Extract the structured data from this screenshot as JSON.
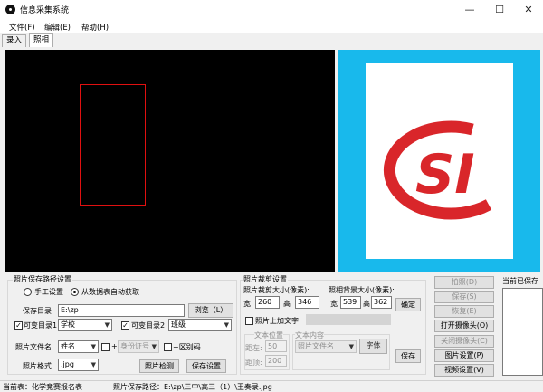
{
  "window": {
    "title": "信息采集系统",
    "buttons": {
      "minimize": "—",
      "maximize": "☐",
      "close": "✕"
    }
  },
  "menu": {
    "file": "文件(F)",
    "edit": "编辑(E)",
    "help": "帮助(H)"
  },
  "tabs": [
    {
      "label": "录入"
    },
    {
      "label": "照相",
      "active": true
    }
  ],
  "preview_logo": {
    "text": "SI",
    "ring_color": "#d9262a"
  },
  "colors": {
    "preview_bg": "#18b9ec",
    "crop_box": "#e01010"
  },
  "save_path_group": {
    "title": "照片保存路径设置",
    "manual_label": "手工设置",
    "auto_label": "从数据表自动获取",
    "dir_label": "保存目录",
    "dir_value": "E:\\zp",
    "browse_btn": "浏览（L）",
    "var_dir1_label": "可变目录1",
    "var_dir1_value": "学校",
    "var_dir2_label": "可变目录2",
    "var_dir2_value": "班级",
    "filename_label": "照片文件名",
    "filename_value": "姓名",
    "plus_sign": "+",
    "id_field_value": "身份证号",
    "plus_id_label": "+区别码",
    "format_label": "照片格式",
    "format_value": ".jpg",
    "check_btn": "照片检测",
    "save_btn": "保存设置"
  },
  "crop_group": {
    "title": "照片裁剪设置",
    "crop_size_label": "照片裁剪大小(像素):",
    "width_label": "宽",
    "width_value": "260",
    "height_label": "高",
    "height_value": "346",
    "bg_size_label": "照相背景大小(像素):",
    "bg_width_label": "宽",
    "bg_width_value": "539",
    "bg_height_label": "高",
    "bg_height_value": "362",
    "confirm_btn": "确定",
    "add_text_label": "照片上加文字",
    "text_pos_label": "文本位置",
    "text_content_label": "文本内容",
    "left_label": "距左:",
    "left_value": "50",
    "top_label": "距顶:",
    "top_value": "200",
    "content_value": "照片文件名",
    "font_btn": "字体",
    "save_btn": "保存"
  },
  "right_buttons": [
    {
      "label": "拍照(D)",
      "enabled": false
    },
    {
      "label": "保存(S)",
      "enabled": false
    },
    {
      "label": "恢复(E)",
      "enabled": false
    },
    {
      "label": "打开摄像头(O)",
      "enabled": true
    },
    {
      "label": "关闭摄像头(C)",
      "enabled": false
    },
    {
      "label": "图片设置(P)",
      "enabled": true
    },
    {
      "label": "视频设置(V)",
      "enabled": true
    }
  ],
  "saved_panel": {
    "title": "当前已保存"
  },
  "status": {
    "current_table": "当前表：化学竞赛报名表",
    "save_path": "照片保存路径：E:\\zp\\三中\\高三（1）\\王奏录.jpg"
  }
}
